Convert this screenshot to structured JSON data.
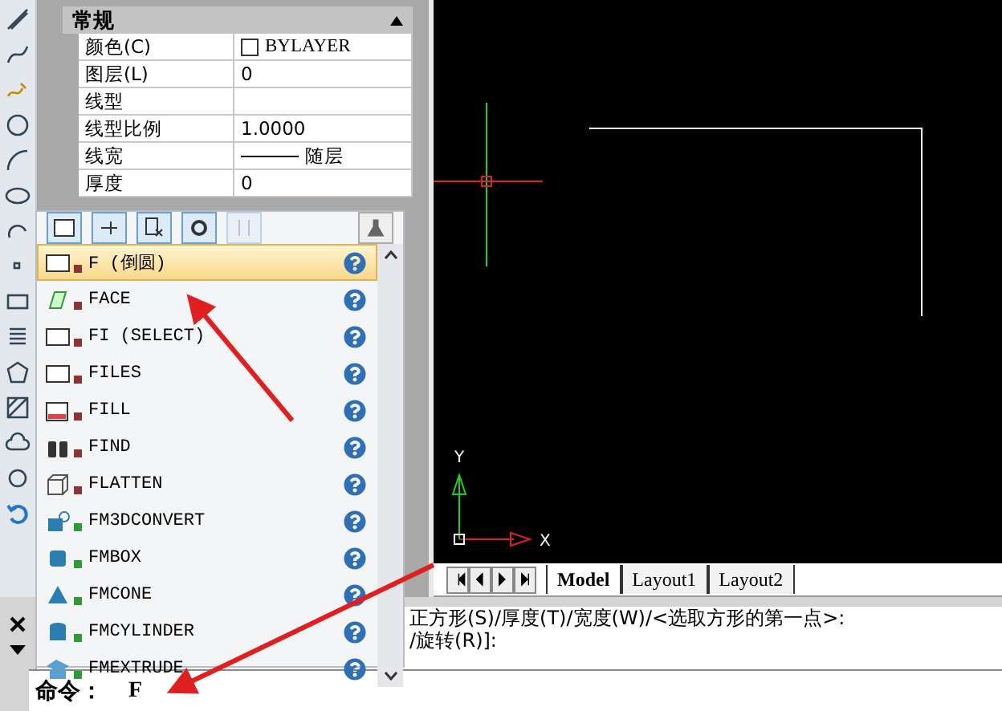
{
  "properties": {
    "section": "常规",
    "expanded": true,
    "rows": [
      {
        "label": "颜色(C)",
        "value": "BYLAYER",
        "kind": "color"
      },
      {
        "label": "图层(L)",
        "value": "0",
        "kind": "text"
      },
      {
        "label": "线型",
        "value": "",
        "kind": "text"
      },
      {
        "label": "线型比例",
        "value": "1.0000",
        "kind": "text"
      },
      {
        "label": "线宽",
        "value": "随层",
        "kind": "lineweight"
      },
      {
        "label": "厚度",
        "value": "0",
        "kind": "text"
      }
    ]
  },
  "canvas": {
    "x_axis": "X",
    "y_axis": "Y"
  },
  "layout_tabs": [
    {
      "label": "Model",
      "selected": true
    },
    {
      "label": "Layout1",
      "selected": false
    },
    {
      "label": "Layout2",
      "selected": false
    }
  ],
  "autocomplete": {
    "items": [
      {
        "label": "F (倒圆)",
        "selected": true,
        "color": "#8b3434"
      },
      {
        "label": "FACE",
        "selected": false,
        "color": "#8b3434"
      },
      {
        "label": "FI (SELECT)",
        "selected": false,
        "color": "#8b3434"
      },
      {
        "label": "FILES",
        "selected": false,
        "color": "#8b3434"
      },
      {
        "label": "FILL",
        "selected": false,
        "color": "#8b3434"
      },
      {
        "label": "FIND",
        "selected": false,
        "color": "#8b3434"
      },
      {
        "label": "FLATTEN",
        "selected": false,
        "color": "#8b3434"
      },
      {
        "label": "FM3DCONVERT",
        "selected": false,
        "color": "#2f9a3a"
      },
      {
        "label": "FMBOX",
        "selected": false,
        "color": "#2f9a3a"
      },
      {
        "label": "FMCONE",
        "selected": false,
        "color": "#2f9a3a"
      },
      {
        "label": "FMCYLINDER",
        "selected": false,
        "color": "#2f9a3a"
      },
      {
        "label": "FMEXTRUDE",
        "selected": false,
        "color": "#2f9a3a"
      }
    ]
  },
  "command": {
    "history": [
      "正方形(S)/厚度(T)/宽度(W)/<选取方形的第一点>:",
      "/旋转(R)]:"
    ],
    "prompt": "命令：",
    "value": "F"
  }
}
